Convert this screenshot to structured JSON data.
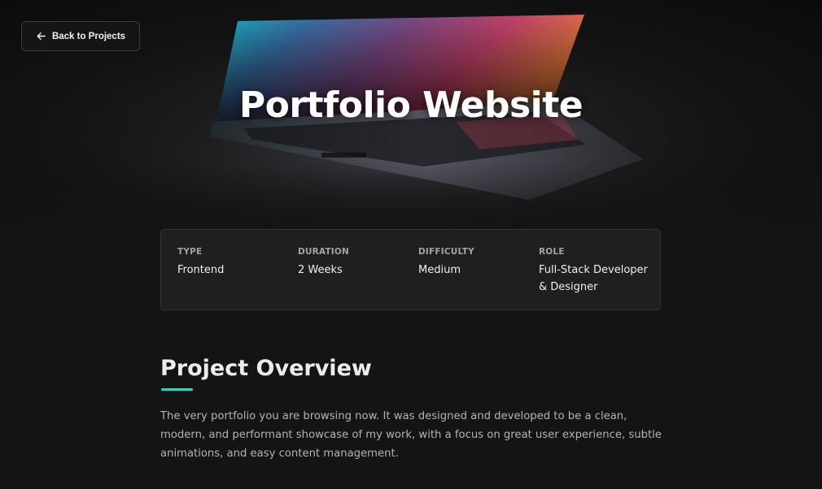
{
  "header": {
    "back_label": "Back to Projects",
    "title": "Portfolio Website"
  },
  "meta": [
    {
      "label": "TYPE",
      "value": "Frontend"
    },
    {
      "label": "DURATION",
      "value": "2 Weeks"
    },
    {
      "label": "DIFFICULTY",
      "value": "Medium"
    },
    {
      "label": "ROLE",
      "value": "Full-Stack Developer & Designer"
    }
  ],
  "overview": {
    "title": "Project Overview",
    "text": "The very portfolio you are browsing now. It was designed and developed to be a clean, modern, and performant showcase of my work, with a focus on great user experience, subtle animations, and easy content management."
  },
  "colors": {
    "accent": "#2dd4bf",
    "background": "#141414"
  },
  "icons": {
    "back": "arrow-left-icon",
    "hero": "laptop-image"
  }
}
